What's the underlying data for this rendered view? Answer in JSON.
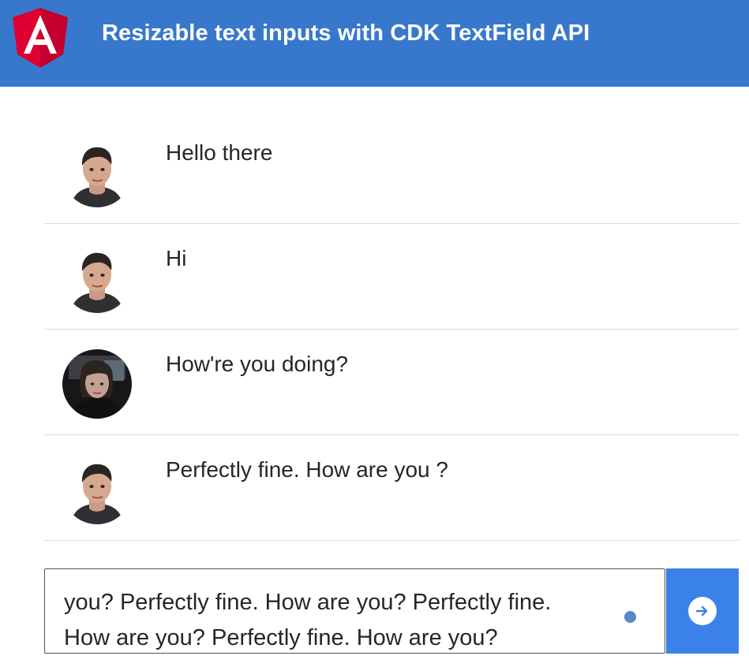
{
  "app": {
    "title": "Resizable text inputs with CDK TextField API",
    "logo_icon": "angular-logo-icon",
    "accent_color": "#3878cc"
  },
  "messages": [
    {
      "text": "Hello there",
      "avatar": "male-avatar"
    },
    {
      "text": "Hi",
      "avatar": "male-avatar"
    },
    {
      "text": "How're you doing?",
      "avatar": "female-avatar"
    },
    {
      "text": "Perfectly fine. How are you ?",
      "avatar": "male-avatar"
    }
  ],
  "composer": {
    "value": "you? Perfectly fine. How are you? Perfectly fine.\nHow are you? Perfectly fine. How are you?",
    "send_icon": "arrow-right-circle-icon",
    "send_button_color": "#3b82e8"
  }
}
